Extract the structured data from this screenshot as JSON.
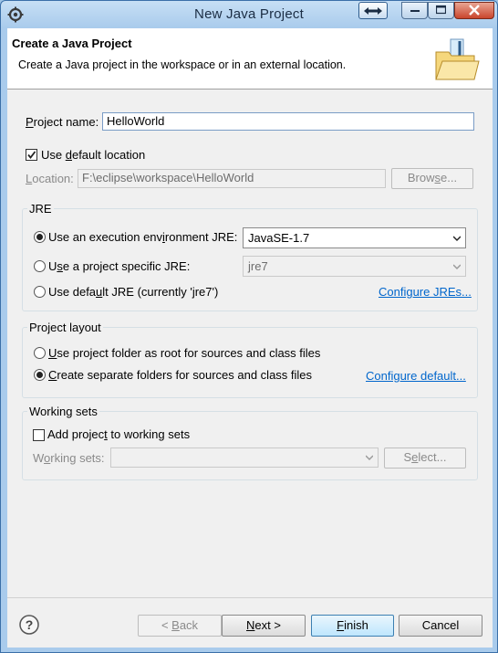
{
  "window": {
    "title": "New Java Project"
  },
  "header": {
    "title": "Create a Java Project",
    "description": "Create a Java project in the workspace or in an external location."
  },
  "project_name": {
    "label_pre": "",
    "label_mnemonic": "P",
    "label_post": "roject name:",
    "value": "HelloWorld"
  },
  "default_location": {
    "label_pre": "Use ",
    "label_mnemonic": "d",
    "label_post": "efault location",
    "checked": true
  },
  "location": {
    "label_pre": "",
    "label_mnemonic": "L",
    "label_post": "ocation:",
    "value": "F:\\eclipse\\workspace\\HelloWorld",
    "browse_pre": "Brow",
    "browse_mnemonic": "s",
    "browse_post": "e..."
  },
  "jre": {
    "group_title": "JRE",
    "option_env_pre": "Use an execution env",
    "option_env_mnemonic": "i",
    "option_env_post": "ronment JRE:",
    "env_value": "JavaSE-1.7",
    "option_specific_pre": "U",
    "option_specific_mnemonic": "s",
    "option_specific_post": "e a project specific JRE:",
    "specific_value": "jre7",
    "option_default_pre": "Use defa",
    "option_default_mnemonic": "u",
    "option_default_post": "lt JRE (currently 'jre7')",
    "configure_link": "Configure JREs...",
    "selected": "env"
  },
  "layout": {
    "group_title": "Project layout",
    "option_root_pre": "",
    "option_root_mnemonic": "U",
    "option_root_post": "se project folder as root for sources and class files",
    "option_separate_pre": "",
    "option_separate_mnemonic": "C",
    "option_separate_post": "reate separate folders for sources and class files",
    "configure_link": "Configure default...",
    "selected": "separate"
  },
  "working_sets": {
    "group_title": "Working sets",
    "add_pre": "Add projec",
    "add_mnemonic": "t",
    "add_post": " to working sets",
    "add_checked": false,
    "label_pre": "W",
    "label_mnemonic": "o",
    "label_post": "rking sets:",
    "value": "",
    "select_pre": "S",
    "select_mnemonic": "e",
    "select_post": "lect..."
  },
  "footer": {
    "help_icon": "help-icon",
    "back_pre": "< ",
    "back_mnemonic": "B",
    "back_post": "ack",
    "next_pre": "",
    "next_mnemonic": "N",
    "next_post": "ext >",
    "finish_pre": "",
    "finish_mnemonic": "F",
    "finish_post": "inish",
    "cancel": "Cancel"
  },
  "colors": {
    "link": "#0066cc",
    "titlebar": "#a9cbec",
    "client": "#f0f0f0"
  }
}
